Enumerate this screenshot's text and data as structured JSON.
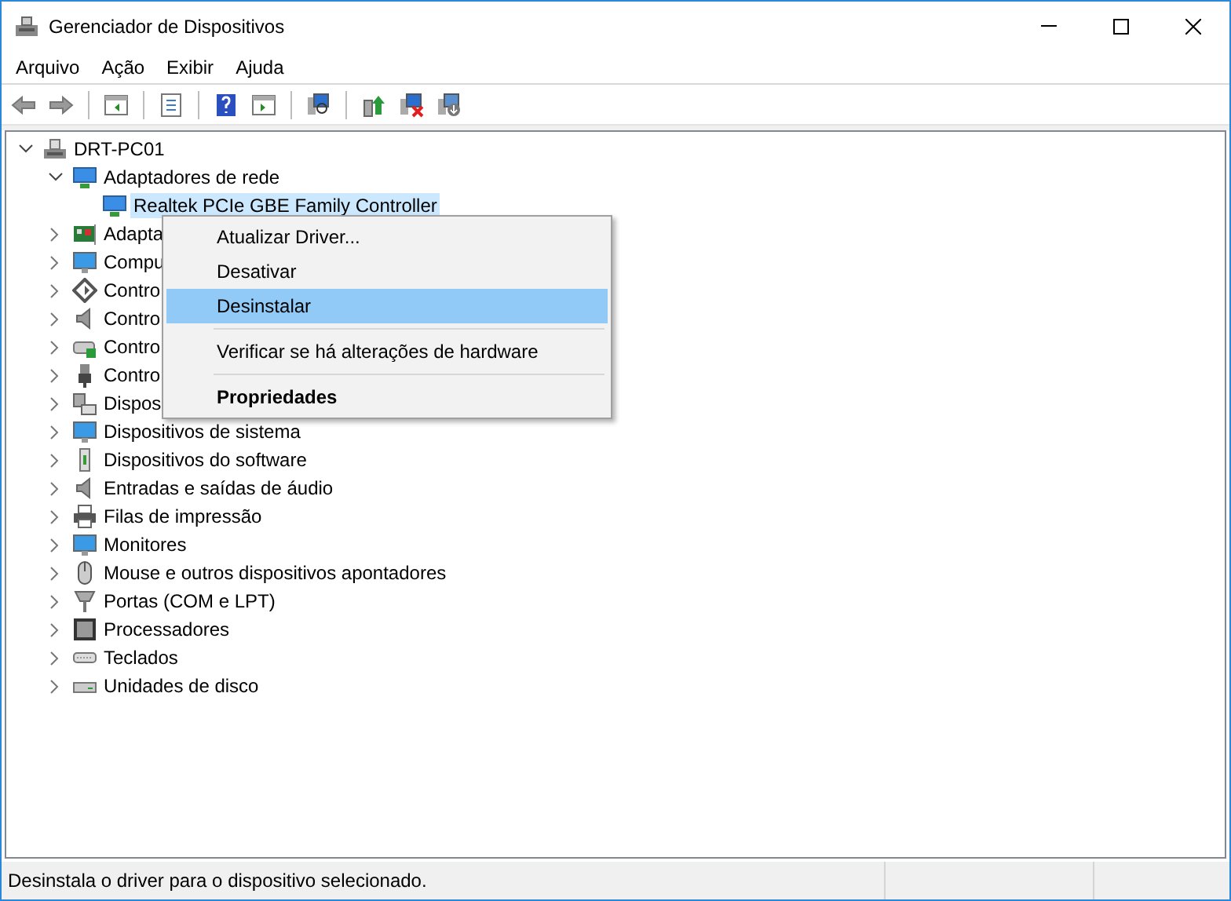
{
  "window": {
    "title": "Gerenciador de Dispositivos"
  },
  "menu": [
    "Arquivo",
    "Ação",
    "Exibir",
    "Ajuda"
  ],
  "tree": {
    "label": "DRT-PC01",
    "kind": "computer",
    "expanded": true,
    "selected": false,
    "children": [
      {
        "label": "Adaptadores de rede",
        "kind": "network",
        "expanded": true,
        "selected": false,
        "children": [
          {
            "label": "Realtek PCIe GBE Family Controller",
            "kind": "network",
            "selected": true
          }
        ]
      },
      {
        "label": "Adapta",
        "kind": "card",
        "expanded": false,
        "selected": false
      },
      {
        "label": "Compu",
        "kind": "display",
        "expanded": false,
        "selected": false
      },
      {
        "label": "Contro",
        "kind": "ide",
        "expanded": false,
        "selected": false
      },
      {
        "label": "Contro",
        "kind": "audio",
        "expanded": false,
        "selected": false
      },
      {
        "label": "Contro",
        "kind": "storage",
        "expanded": false,
        "selected": false
      },
      {
        "label": "Contro",
        "kind": "usb",
        "expanded": false,
        "selected": false
      },
      {
        "label": "Dispos",
        "kind": "hid",
        "expanded": false,
        "selected": false
      },
      {
        "label": "Dispositivos de sistema",
        "kind": "display",
        "expanded": false,
        "selected": false
      },
      {
        "label": "Dispositivos do software",
        "kind": "software",
        "expanded": false,
        "selected": false
      },
      {
        "label": "Entradas e saídas de áudio",
        "kind": "audio",
        "expanded": false,
        "selected": false
      },
      {
        "label": "Filas de impressão",
        "kind": "printer",
        "expanded": false,
        "selected": false
      },
      {
        "label": "Monitores",
        "kind": "display",
        "expanded": false,
        "selected": false
      },
      {
        "label": "Mouse e outros dispositivos apontadores",
        "kind": "mouse",
        "expanded": false,
        "selected": false
      },
      {
        "label": "Portas (COM e LPT)",
        "kind": "port",
        "expanded": false,
        "selected": false
      },
      {
        "label": "Processadores",
        "kind": "cpu",
        "expanded": false,
        "selected": false
      },
      {
        "label": "Teclados",
        "kind": "keyboard",
        "expanded": false,
        "selected": false
      },
      {
        "label": "Unidades de disco",
        "kind": "disk",
        "expanded": false,
        "selected": false
      }
    ]
  },
  "context_menu": [
    {
      "kind": "item",
      "label": "Atualizar Driver...",
      "selected": false,
      "default": false
    },
    {
      "kind": "item",
      "label": "Desativar",
      "selected": false,
      "default": false
    },
    {
      "kind": "item",
      "label": "Desinstalar",
      "selected": true,
      "default": false
    },
    {
      "kind": "separator"
    },
    {
      "kind": "item",
      "label": "Verificar se há alterações de hardware",
      "selected": false,
      "default": false
    },
    {
      "kind": "separator"
    },
    {
      "kind": "item",
      "label": "Propriedades",
      "selected": false,
      "default": true
    }
  ],
  "status_bar": {
    "text": "Desinstala o driver para o dispositivo selecionado."
  }
}
